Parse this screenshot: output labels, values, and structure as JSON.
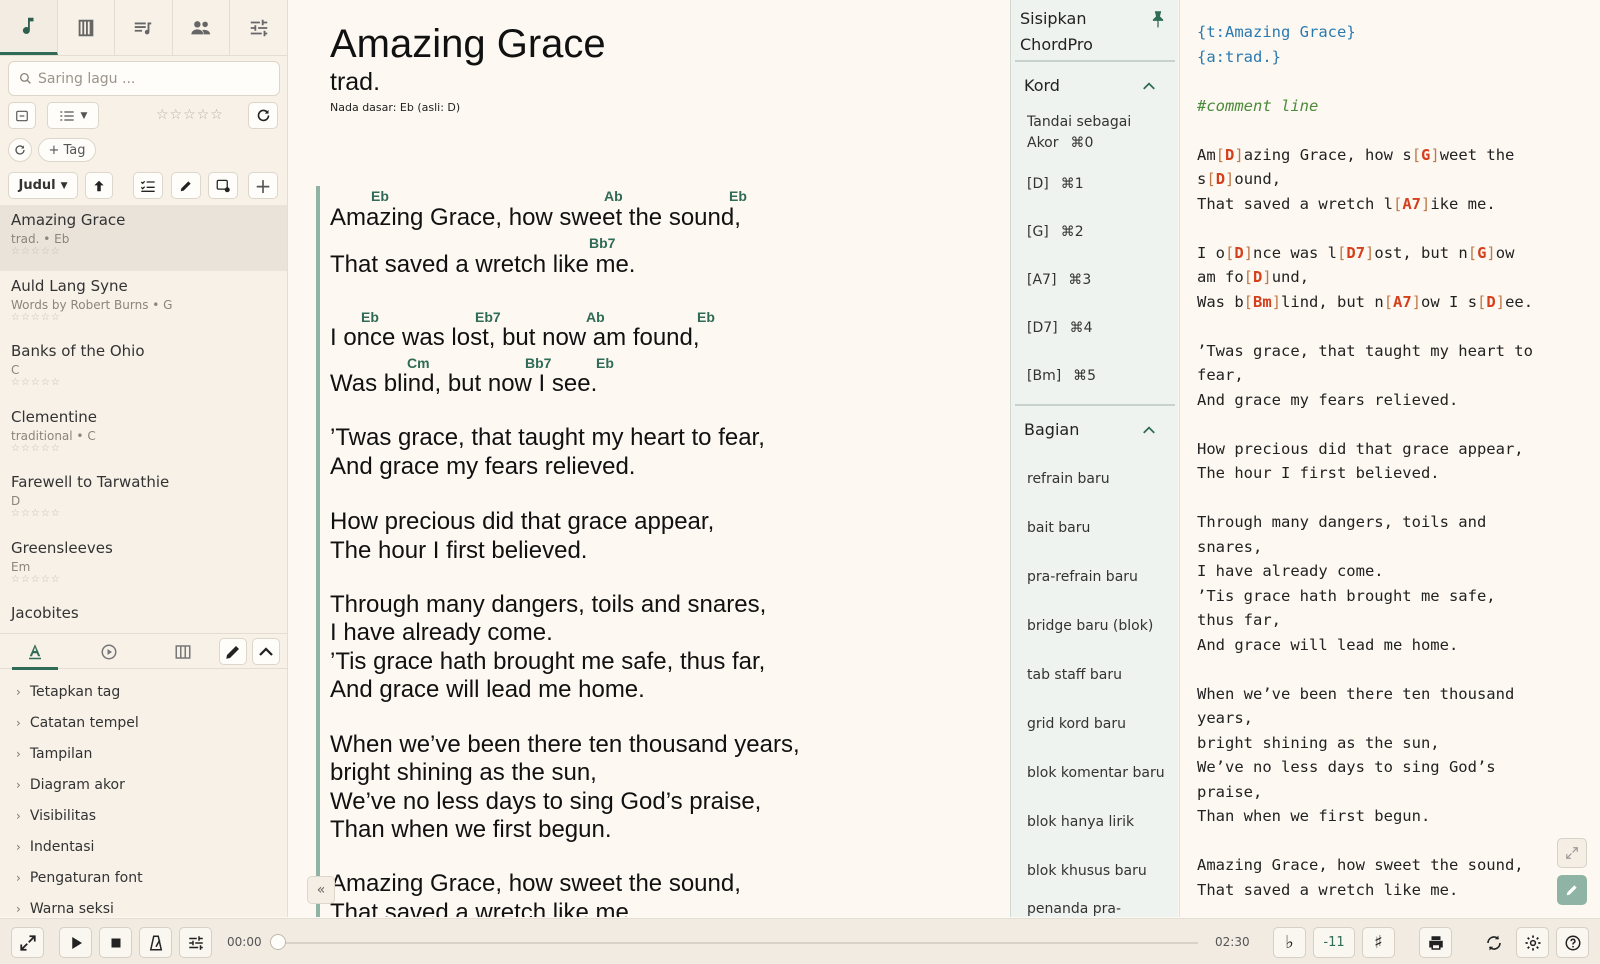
{
  "sidebar": {
    "search_placeholder": "Saring lagu ...",
    "tag_button": "+ Tag",
    "sort_label": "Judul",
    "rating_stars": "☆☆☆☆☆",
    "songs": [
      {
        "title": "Amazing Grace",
        "meta": "trad. • Eb",
        "rating": "☆☆☆☆☆"
      },
      {
        "title": "Auld Lang Syne",
        "meta": "Words by Robert Burns • G",
        "rating": "☆☆☆☆☆"
      },
      {
        "title": "Banks of the Ohio",
        "meta": "C",
        "rating": "☆☆☆☆☆"
      },
      {
        "title": "Clementine",
        "meta": "traditional • C",
        "rating": "☆☆☆☆☆"
      },
      {
        "title": "Farewell to Tarwathie",
        "meta": "D",
        "rating": "☆☆☆☆☆"
      },
      {
        "title": "Greensleeves",
        "meta": "Em",
        "rating": "☆☆☆☆☆"
      },
      {
        "title": "Jacobites",
        "meta": "",
        "rating": ""
      }
    ],
    "sections": [
      "Tetapkan tag",
      "Catatan tempel",
      "Tampilan",
      "Diagram akor",
      "Visibilitas",
      "Indentasi",
      "Pengaturan font",
      "Warna seksi"
    ]
  },
  "song": {
    "title": "Amazing Grace",
    "artist": "trad.",
    "key_line": "Nada dasar: Eb (asli: D)",
    "lines": [
      "Amazing Grace, how sweet the sound,",
      "That saved a wretch like me.",
      "I once was lost, but now am found,",
      "Was blind, but now I see.",
      "’Twas grace, that taught my heart to fear,",
      "And grace my fears relieved.",
      "How precious did that grace appear,",
      "The hour I first believed.",
      "Through many dangers, toils and snares,",
      "I have already come.",
      "’Tis grace hath brought me safe, thus far,",
      "And grace will lead me home.",
      "When we’ve been there ten thousand years,",
      "bright shining as the sun,",
      "We’ve no less days to sing God’s praise,",
      "Than when we first begun.",
      "Amazing Grace, how sweet the sound,",
      "That saved a wretch like me."
    ],
    "chords": {
      "l1": [
        "Eb",
        "Ab",
        "Eb"
      ],
      "l2": [
        "Bb7"
      ],
      "l3": [
        "Eb",
        "Eb7",
        "Ab",
        "Eb"
      ],
      "l4": [
        "Cm",
        "Bb7",
        "Eb"
      ]
    }
  },
  "insert": {
    "title_line1": "Sisipkan",
    "title_line2": "ChordPro",
    "chords_header": "Kord",
    "mark_chord_line1": "Tandai sebagai",
    "mark_chord_line2": "Akor",
    "mark_chord_key": "⌘0",
    "chord_items": [
      {
        "label": "[D]",
        "key": "⌘1"
      },
      {
        "label": "[G]",
        "key": "⌘2"
      },
      {
        "label": "[A7]",
        "key": "⌘3"
      },
      {
        "label": "[D7]",
        "key": "⌘4"
      },
      {
        "label": "[Bm]",
        "key": "⌘5"
      }
    ],
    "sections_header": "Bagian",
    "section_items": [
      "refrain baru",
      "bait baru",
      "pra-refrain baru",
      "bridge baru (blok)",
      "tab staff baru",
      "grid kord baru",
      "blok komentar baru",
      "blok hanya lirik",
      "blok khusus baru",
      "penanda pra-"
    ]
  },
  "editor": {
    "d1_open": "{t:",
    "d1_val": "Amazing Grace",
    "d1_close": "}",
    "d2_open": "{a:",
    "d2_val": "trad.",
    "d2_close": "}",
    "comment": "#comment line",
    "l1a": "Am",
    "l1c1": "D",
    "l1b": "azing Grace, how s",
    "l1c2": "G",
    "l1c": "weet the",
    "l2a": "s",
    "l2c1": "D",
    "l2b": "ound,",
    "l3a": "That saved a wretch l",
    "l3c1": "A7",
    "l3b": "ike me.",
    "l4a": "I o",
    "l4c1": "D",
    "l4b": "nce was l",
    "l4c2": "D7",
    "l4c": "ost, but n",
    "l4c3": "G",
    "l4d": "ow",
    "l5a": "am fo",
    "l5c1": "D",
    "l5b": "und,",
    "l6a": "Was b",
    "l6c1": "Bm",
    "l6b": "lind, but n",
    "l6c2": "A7",
    "l6c": "ow I s",
    "l6c3": "D",
    "l6d": "ee.",
    "plain": [
      "’Twas grace, that taught my heart to",
      "fear,",
      "And grace my fears relieved.",
      "",
      "How precious did that grace appear,",
      "The hour I first believed.",
      "",
      "Through many dangers, toils and",
      "snares,",
      "I have already come.",
      "’Tis grace hath brought me safe,",
      "thus far,",
      "And grace will lead me home.",
      "",
      "When we’ve been there ten thousand",
      "years,",
      "bright shining as the sun,",
      "We’ve no less days to sing God’s",
      "praise,",
      "Than when we first begun.",
      "",
      "Amazing Grace, how sweet the sound,",
      "That saved a wretch like me."
    ]
  },
  "player": {
    "time_start": "00:00",
    "time_end": "02:30",
    "transpose_value": "-11",
    "flat_label": "♭",
    "sharp_label": "♯"
  },
  "colors": {
    "accent": "#2f6b56",
    "chord_green": "#2f6b56",
    "chord_red": "#d4401c",
    "directive_blue": "#2a7ab0",
    "comment_green": "#4a8a3a"
  }
}
